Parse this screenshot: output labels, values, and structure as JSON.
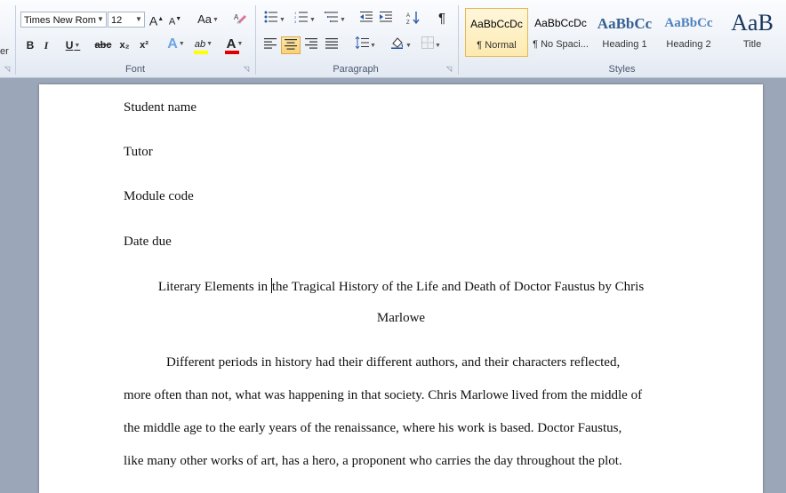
{
  "ribbon": {
    "edge_text": "er",
    "font": {
      "group_label": "Font",
      "font_name": "Times New Rom",
      "font_size": "12",
      "grow_label": "A",
      "shrink_label": "A",
      "case_label": "Aa",
      "bold": "B",
      "italic": "I",
      "underline": "U",
      "strike": "abc",
      "sub": "x₂",
      "sup": "x²",
      "text_effect": "A",
      "highlight": "ab",
      "font_color": "A"
    },
    "paragraph": {
      "group_label": "Paragraph",
      "pilcrow": "¶"
    },
    "styles": {
      "group_label": "Styles",
      "tiles": [
        {
          "sample": "AaBbCcDc",
          "name": "¶ Normal"
        },
        {
          "sample": "AaBbCcDc",
          "name": "¶ No Spaci..."
        },
        {
          "sample": "AaBbCc",
          "name": "Heading 1"
        },
        {
          "sample": "AaBbCc",
          "name": "Heading 2"
        },
        {
          "sample": "AaB",
          "name": "Title"
        }
      ]
    },
    "colors": {
      "highlight_bar": "#ffff00",
      "font_color_bar": "#e00000",
      "heading_blue": "#365f91"
    }
  },
  "document": {
    "student_name": "Student name",
    "tutor": "Tutor",
    "module_code": "Module code",
    "date_due": "Date due",
    "title_part1": "Literary Elements in ",
    "title_part2": "the Tragical History of the Life and Death of Doctor Faustus by Chris",
    "title_line2": "Marlowe",
    "body": [
      "Different periods in history had their different authors, and their characters reflected,",
      "more often than not, what was happening in that society. Chris Marlowe lived from the middle of",
      "the middle age to the early years of the renaissance, where his work is based. Doctor Faustus,",
      "like many other works of art, has a hero, a proponent who carries the day throughout the plot."
    ]
  }
}
